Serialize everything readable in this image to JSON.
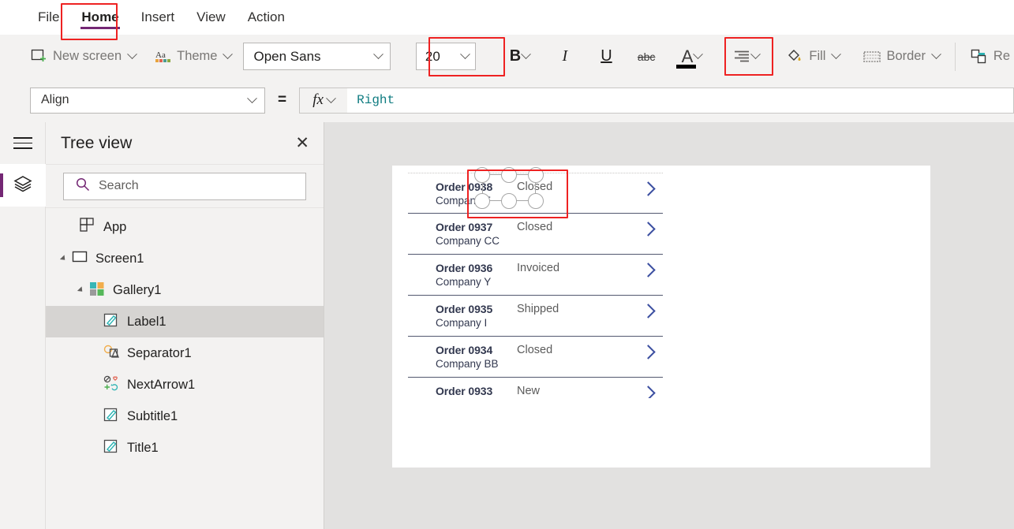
{
  "menubar": {
    "items": [
      {
        "label": "File",
        "active": false
      },
      {
        "label": "Home",
        "active": true
      },
      {
        "label": "Insert",
        "active": false
      },
      {
        "label": "View",
        "active": false
      },
      {
        "label": "Action",
        "active": false
      }
    ]
  },
  "ribbon": {
    "new_screen": "New screen",
    "theme": "Theme",
    "font_family": "Open Sans",
    "font_size": "20",
    "bold": "B",
    "italic": "I",
    "underline": "U",
    "strikethrough": "abc",
    "font_color": "A",
    "align": "align-right-icon",
    "fill": "Fill",
    "border": "Border",
    "reorder": "Re",
    "accent_color": "#742774",
    "highlight_color": "#ee2222"
  },
  "formula_bar": {
    "property": "Align",
    "equals": "=",
    "fx": "fx",
    "value": "Right",
    "value_color": "#0f7c81"
  },
  "rail": {
    "hamburger": "hamburger-icon",
    "tree_view": "layers-icon"
  },
  "treeview": {
    "title": "Tree view",
    "close": "✕",
    "search_placeholder": "Search",
    "items": [
      {
        "label": "App",
        "icon": "app-icon",
        "indent": 0,
        "twisty": false,
        "selected": false
      },
      {
        "label": "Screen1",
        "icon": "screen-icon",
        "indent": 0,
        "twisty": true,
        "selected": false
      },
      {
        "label": "Gallery1",
        "icon": "gallery-icon",
        "indent": 1,
        "twisty": true,
        "selected": false
      },
      {
        "label": "Label1",
        "icon": "label-icon",
        "indent": 2,
        "twisty": false,
        "selected": true
      },
      {
        "label": "Separator1",
        "icon": "shapes-icon",
        "indent": 2,
        "twisty": false,
        "selected": false
      },
      {
        "label": "NextArrow1",
        "icon": "icons-icon",
        "indent": 2,
        "twisty": false,
        "selected": false
      },
      {
        "label": "Subtitle1",
        "icon": "label-icon",
        "indent": 2,
        "twisty": false,
        "selected": false
      },
      {
        "label": "Title1",
        "icon": "label-icon",
        "indent": 2,
        "twisty": false,
        "selected": false
      }
    ]
  },
  "canvas": {
    "gallery_rows": [
      {
        "title": "Order 0938",
        "subtitle": "Company F",
        "status": "Closed",
        "selected": true,
        "clipped": false
      },
      {
        "title": "Order 0937",
        "subtitle": "Company CC",
        "status": "Closed",
        "selected": false,
        "clipped": false
      },
      {
        "title": "Order 0936",
        "subtitle": "Company Y",
        "status": "Invoiced",
        "selected": false,
        "clipped": false
      },
      {
        "title": "Order 0935",
        "subtitle": "Company I",
        "status": "Shipped",
        "selected": false,
        "clipped": false
      },
      {
        "title": "Order 0934",
        "subtitle": "Company BB",
        "status": "Closed",
        "selected": false,
        "clipped": false
      },
      {
        "title": "Order 0933",
        "subtitle": "",
        "status": "New",
        "selected": false,
        "clipped": true
      }
    ]
  }
}
